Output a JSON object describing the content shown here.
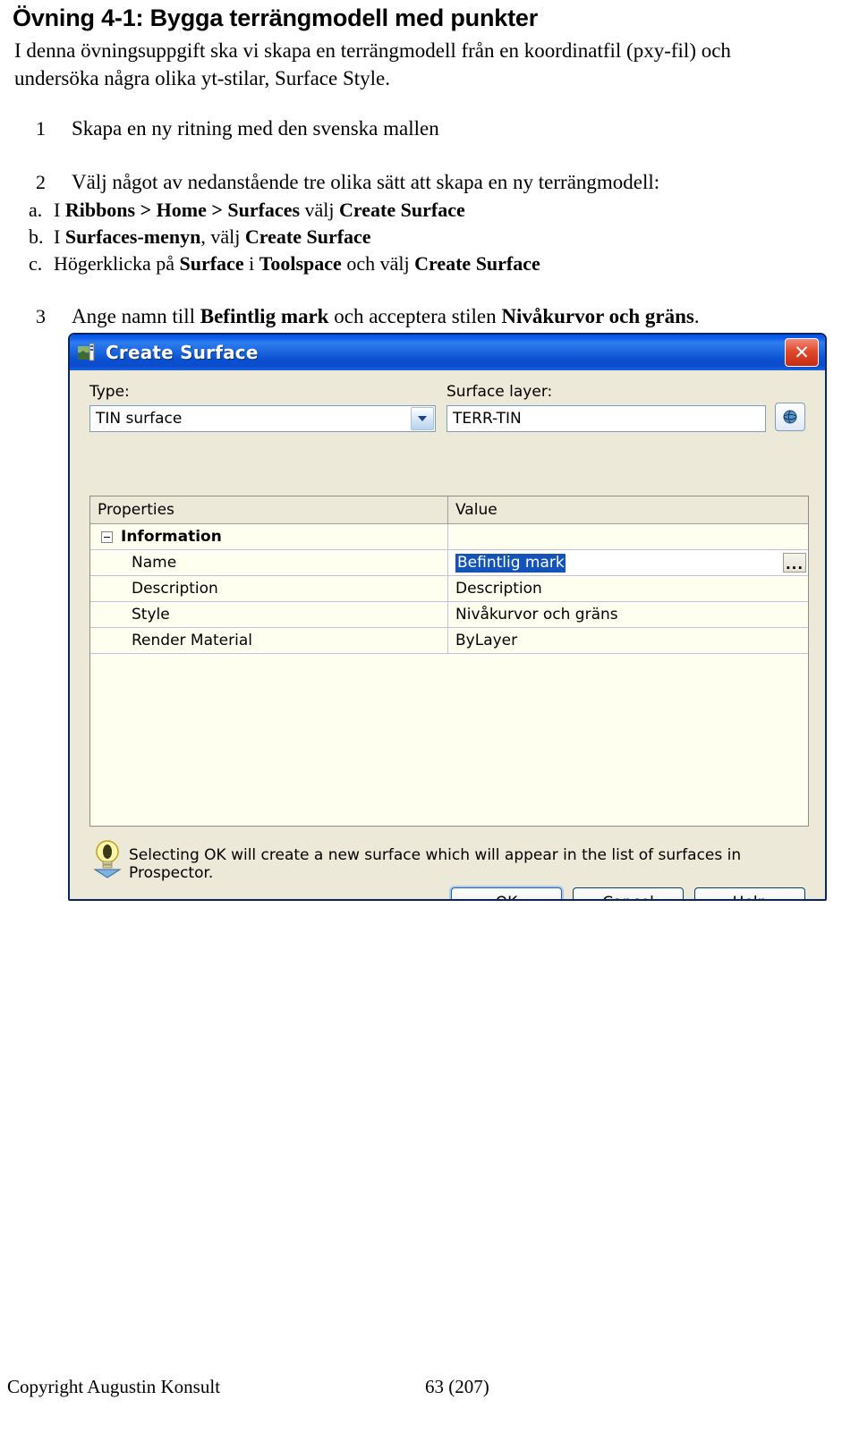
{
  "document": {
    "title": "Övning 4-1: Bygga terrängmodell med punkter",
    "intro": "I denna övningsuppgift ska vi skapa en terrängmodell från en koordinatfil (pxy-fil) och undersöka några olika yt-stilar, Surface Style.",
    "steps": [
      {
        "number": "1",
        "text": "Skapa en ny ritning med den svenska mallen"
      },
      {
        "number": "2",
        "text": "Välj något av nedanstående tre olika sätt att skapa en ny terrängmodell:",
        "substeps": [
          {
            "marker": "a.",
            "parts": [
              {
                "t": "I ",
                "b": false
              },
              {
                "t": "Ribbons > Home > Surfaces",
                "b": true
              },
              {
                "t": " välj ",
                "b": false
              },
              {
                "t": "Create Surface",
                "b": true
              }
            ]
          },
          {
            "marker": "b.",
            "parts": [
              {
                "t": "I ",
                "b": false
              },
              {
                "t": "Surfaces-menyn",
                "b": true
              },
              {
                "t": ", välj ",
                "b": false
              },
              {
                "t": "Create Surface",
                "b": true
              }
            ]
          },
          {
            "marker": "c.",
            "parts": [
              {
                "t": "Högerklicka på ",
                "b": false
              },
              {
                "t": "Surface",
                "b": true
              },
              {
                "t": " i ",
                "b": false
              },
              {
                "t": "Toolspace",
                "b": true
              },
              {
                "t": " och välj ",
                "b": false
              },
              {
                "t": "Create Surface",
                "b": true
              }
            ]
          }
        ]
      },
      {
        "number": "3",
        "parts": [
          {
            "t": "Ange namn till ",
            "b": false
          },
          {
            "t": "Befintlig mark",
            "b": true
          },
          {
            "t": " och acceptera stilen ",
            "b": false
          },
          {
            "t": "Nivåkurvor och gräns",
            "b": true
          },
          {
            "t": ".",
            "b": false
          }
        ]
      }
    ]
  },
  "dialog": {
    "title": "Create Surface",
    "title_icon": "surface-icon",
    "close_icon": "close-icon",
    "type": {
      "label": "Type:",
      "value": "TIN surface",
      "dropdown_icon": "chevron-down-icon"
    },
    "surface_layer": {
      "label": "Surface layer:",
      "value": "TERR-TIN",
      "picker_icon": "layer-picker-icon"
    },
    "grid": {
      "headers": [
        "Properties",
        "Value"
      ],
      "group": {
        "label": "Information",
        "expander_state": "expanded"
      },
      "rows": [
        {
          "property": "Name",
          "value": "Befintlig mark",
          "selected": true,
          "has_ellipsis": true
        },
        {
          "property": "Description",
          "value": "Description",
          "selected": false,
          "has_ellipsis": false
        },
        {
          "property": "Style",
          "value": "Nivåkurvor och gräns",
          "selected": false,
          "has_ellipsis": false
        },
        {
          "property": "Render Material",
          "value": "ByLayer",
          "selected": false,
          "has_ellipsis": false
        }
      ],
      "ellipsis_label": "..."
    },
    "hint": {
      "icon": "lightbulb-icon",
      "text": "Selecting OK will create a new surface which will appear in the list of surfaces in Prospector."
    },
    "buttons": [
      {
        "label": "OK",
        "default": true
      },
      {
        "label": "Cancel",
        "default": false
      },
      {
        "label": "Help",
        "default": false
      }
    ]
  },
  "footer": {
    "left": "Copyright Augustin Konsult",
    "center": "63 (207)"
  },
  "colors": {
    "titlebar_blue": "#0a50d0",
    "dialog_face": "#ece9d8",
    "grid_background": "#fffff0",
    "selection_blue": "#1453b8",
    "close_red": "#c32b12"
  }
}
